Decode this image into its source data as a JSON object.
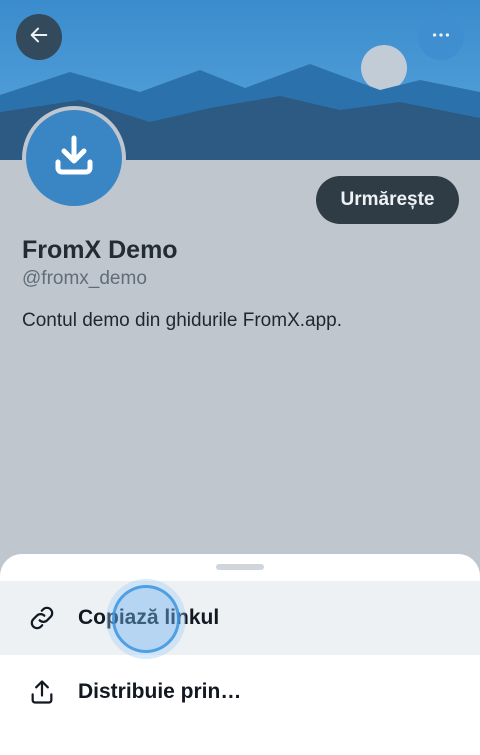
{
  "profile": {
    "name": "FromX Demo",
    "handle": "@fromx_demo",
    "bio": "Contul demo din ghidurile FromX.app.",
    "follow_label": "Urmărește"
  },
  "header": {
    "back_icon": "arrow-left-icon",
    "more_icon": "more-horizontal-icon"
  },
  "sheet": {
    "items": [
      {
        "label": "Copiază linkul",
        "icon": "link-icon"
      },
      {
        "label": "Distribuie prin…",
        "icon": "share-icon"
      }
    ]
  },
  "colors": {
    "banner_sky": "#4a9ad6",
    "accent": "#3a86c4",
    "follow_button": "#2f3c46"
  }
}
